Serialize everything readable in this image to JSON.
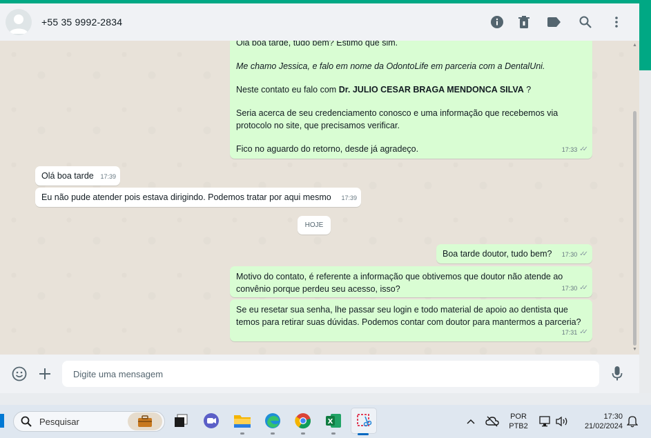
{
  "header": {
    "contact_name": "+55 35 9992-2834",
    "icons": [
      "info-icon",
      "trash-icon",
      "label-icon",
      "search-icon",
      "more-vert-icon"
    ]
  },
  "messages": {
    "m1": {
      "p1": "Olá boa tarde, tudo bem? Estimo que sim.",
      "p2": "Me chamo Jessica, e falo em nome da OdontoLife em parceria com a DentalUni.",
      "p3_prefix": "Neste contato eu falo com ",
      "p3_bold": "Dr. JULIO CESAR BRAGA MENDONCA SILVA",
      "p3_suffix": " ?",
      "p4": "Seria acerca de seu credenciamento conosco e uma informação que recebemos via protocolo no site, que precisamos verificar.",
      "p5": "Fico no aguardo do retorno, desde já agradeço.",
      "time": "17:33"
    },
    "m2": {
      "text": "Olá boa tarde",
      "time": "17:39"
    },
    "m3": {
      "text": "Eu não pude atender pois estava dirigindo. Podemos tratar por aqui mesmo",
      "time": "17:39"
    },
    "day_divider": "HOJE",
    "m4": {
      "text": "Boa tarde doutor, tudo bem?",
      "time": "17:30"
    },
    "m5": {
      "text": "Motivo do contato, é referente a informação que obtivemos que doutor não atende ao convênio porque perdeu seu acesso, isso?",
      "time": "17:30"
    },
    "m6": {
      "text": "Se eu resetar sua senha, lhe passar seu login e todo material de apoio ao dentista que temos para retirar suas dúvidas. Podemos contar com doutor para mantermos a parceria?",
      "time": "17:31"
    }
  },
  "composer": {
    "placeholder": "Digite uma mensagem"
  },
  "taskbar": {
    "search_placeholder": "Pesquisar",
    "apps": [
      "briefcase-icon",
      "task-view-icon",
      "teams-icon",
      "file-explorer-icon",
      "edge-icon",
      "chrome-icon",
      "excel-icon",
      "snipping-tool-icon"
    ],
    "lang_top": "POR",
    "lang_bottom": "PTB2",
    "time": "17:30",
    "date": "21/02/2024"
  },
  "colors": {
    "accent": "#00a884",
    "outgoing_bubble": "#d9fdd3",
    "incoming_bubble": "#ffffff",
    "header_bg": "#f0f2f5"
  }
}
